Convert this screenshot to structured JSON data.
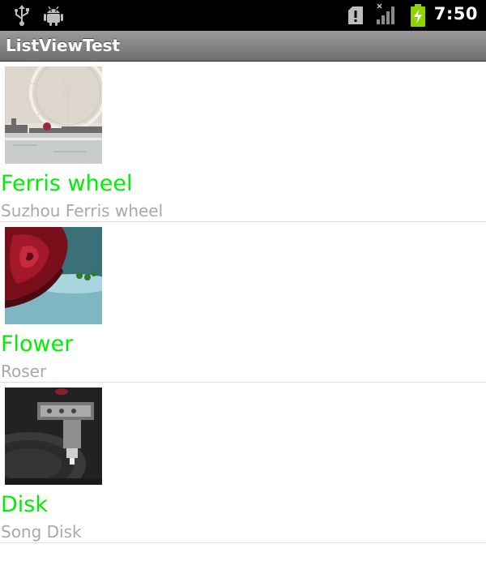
{
  "status_bar": {
    "time": "7:50",
    "icons": [
      "usb-icon",
      "android-debug-icon",
      "sd-card-alert-icon",
      "no-signal-icon",
      "battery-charging-icon"
    ]
  },
  "app": {
    "title": "ListViewTest"
  },
  "colors": {
    "item_title": "#00ee00",
    "item_subtitle": "#a8a8a8",
    "divider": "#dcdcdc",
    "title_bar": "#808080"
  },
  "list": {
    "items": [
      {
        "title": "Ferris wheel",
        "subtitle": "Suzhou Ferris wheel",
        "image": "ferris-wheel-image"
      },
      {
        "title": "Flower",
        "subtitle": "Roser",
        "image": "rose-image"
      },
      {
        "title": "Disk",
        "subtitle": "Song Disk",
        "image": "record-player-image"
      }
    ]
  }
}
